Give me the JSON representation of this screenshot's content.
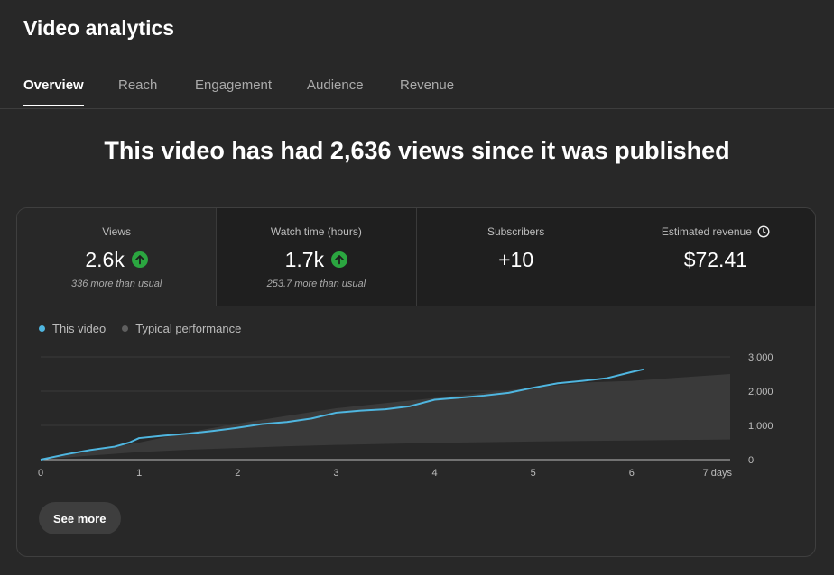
{
  "page_title": "Video analytics",
  "tabs": [
    {
      "label": "Overview",
      "active": true
    },
    {
      "label": "Reach",
      "active": false
    },
    {
      "label": "Engagement",
      "active": false
    },
    {
      "label": "Audience",
      "active": false
    },
    {
      "label": "Revenue",
      "active": false
    }
  ],
  "headline": "This video has had 2,636 views since it was published",
  "metrics": [
    {
      "label": "Views",
      "value": "2.6k",
      "note": "336 more than usual",
      "trend": "up"
    },
    {
      "label": "Watch time (hours)",
      "value": "1.7k",
      "note": "253.7 more than usual",
      "trend": "up"
    },
    {
      "label": "Subscribers",
      "value": "+10",
      "note": ""
    },
    {
      "label": "Estimated revenue",
      "value": "$72.41",
      "note": "",
      "icon": "clock-icon"
    }
  ],
  "legend": {
    "this_video": "This video",
    "typical": "Typical performance"
  },
  "colors": {
    "this_video": "#3ea6ff",
    "line": "#4fb6e0",
    "typical": "#5f5f5f",
    "up": "#2ba640"
  },
  "see_more": "See more",
  "chart_data": {
    "type": "line",
    "x_ticks": [
      "0",
      "1",
      "2",
      "3",
      "4",
      "5",
      "6",
      "7 days"
    ],
    "y_ticks": [
      "0",
      "1,000",
      "2,000",
      "3,000"
    ],
    "xlim": [
      0,
      7
    ],
    "ylim": [
      0,
      3000
    ],
    "grid": true,
    "legend_position": "top-left",
    "series": [
      {
        "name": "This video",
        "x": [
          0,
          0.25,
          0.5,
          0.75,
          0.9,
          1.0,
          1.25,
          1.5,
          1.75,
          2.0,
          2.25,
          2.5,
          2.75,
          3.0,
          3.25,
          3.5,
          3.75,
          4.0,
          4.25,
          4.5,
          4.75,
          5.0,
          5.25,
          5.5,
          5.75,
          6.0,
          6.12
        ],
        "y": [
          0,
          150,
          280,
          380,
          500,
          630,
          700,
          760,
          840,
          930,
          1040,
          1100,
          1200,
          1370,
          1430,
          1470,
          1560,
          1750,
          1810,
          1870,
          1950,
          2100,
          2230,
          2300,
          2380,
          2560,
          2636
        ]
      },
      {
        "name": "Typical performance",
        "type": "area",
        "x": [
          0,
          0.5,
          1.0,
          1.5,
          2.0,
          2.5,
          3.0,
          3.5,
          4.0,
          4.5,
          5.0,
          5.5,
          6.0,
          6.5,
          7.0
        ],
        "y_low": [
          0,
          120,
          220,
          290,
          340,
          390,
          430,
          460,
          490,
          510,
          530,
          545,
          560,
          575,
          590
        ],
        "y_high": [
          0,
          250,
          500,
          800,
          1050,
          1280,
          1500,
          1650,
          1800,
          1950,
          2100,
          2250,
          2300,
          2400,
          2500
        ]
      }
    ]
  }
}
